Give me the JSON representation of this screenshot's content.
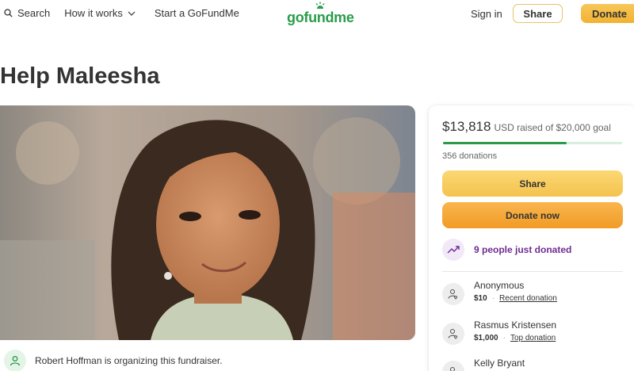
{
  "header": {
    "search_label": "Search",
    "how_it_works_label": "How it works",
    "start_label": "Start a GoFundMe",
    "logo_text": "gofundme",
    "signin_label": "Sign in",
    "share_label": "Share",
    "donate_label": "Donate"
  },
  "campaign": {
    "title": "Help Maleesha",
    "organizer_text": "Robert Hoffman is organizing this fundraiser."
  },
  "donation_card": {
    "amount_raised": "$13,818",
    "goal_text": "USD raised of $20,000 goal",
    "progress_fraction": 0.69,
    "donation_count": "356 donations",
    "share_label": "Share",
    "donate_label": "Donate now",
    "recent_activity": "9 people just donated",
    "donors": [
      {
        "name": "Anonymous",
        "amount": "$10",
        "tag": "Recent donation"
      },
      {
        "name": "Rasmus Kristensen",
        "amount": "$1,000",
        "tag": "Top donation"
      },
      {
        "name": "Kelly Bryant",
        "amount": "",
        "tag": ""
      }
    ]
  },
  "colors": {
    "brand_green": "#2a9c4a",
    "accent_orange": "#f2b231",
    "purple": "#6f2c91"
  }
}
